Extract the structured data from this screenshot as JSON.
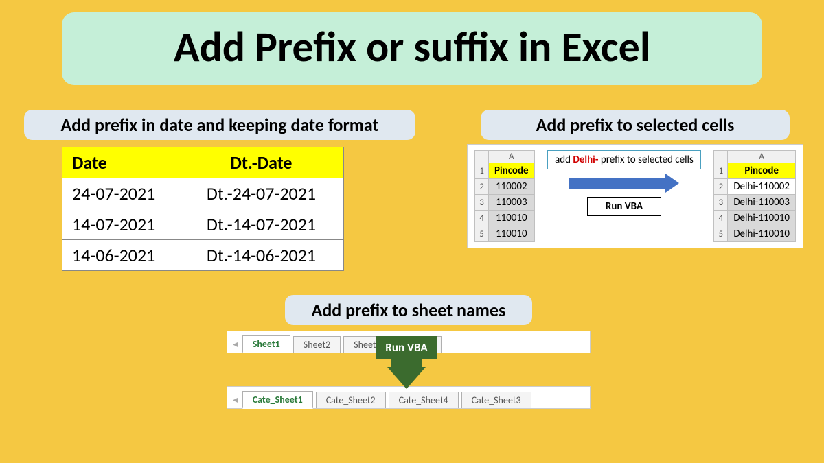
{
  "title": "Add Prefix or suffix in Excel",
  "section1": {
    "heading": "Add prefix in date and keeping date format",
    "headers": {
      "c1": "Date",
      "c2": "Dt.-Date"
    },
    "rows": [
      {
        "c1": "24-07-2021",
        "c2": "Dt.-24-07-2021"
      },
      {
        "c1": "14-07-2021",
        "c2": "Dt.-14-07-2021"
      },
      {
        "c1": "14-06-2021",
        "c2": "Dt.-14-06-2021"
      }
    ]
  },
  "section2": {
    "heading": "Add prefix to selected cells",
    "col_letter": "A",
    "left_header": "Pincode",
    "left_rows": [
      "110002",
      "110003",
      "110010",
      "110010"
    ],
    "callout_prefix": "Delhi-",
    "callout_pre": "add ",
    "callout_post": " prefix to selected cells",
    "runvba": "Run VBA",
    "right_header": "Pincode",
    "right_rows": [
      "Delhi-110002",
      "Delhi-110003",
      "Delhi-110010",
      "Delhi-110010"
    ]
  },
  "section3": {
    "heading": "Add prefix to sheet names",
    "before_tabs": [
      "Sheet1",
      "Sheet2",
      "Sheet4",
      "Sheet3"
    ],
    "runvba": "Run VBA",
    "after_tabs": [
      "Cate_Sheet1",
      "Cate_Sheet2",
      "Cate_Sheet4",
      "Cate_Sheet3"
    ]
  }
}
